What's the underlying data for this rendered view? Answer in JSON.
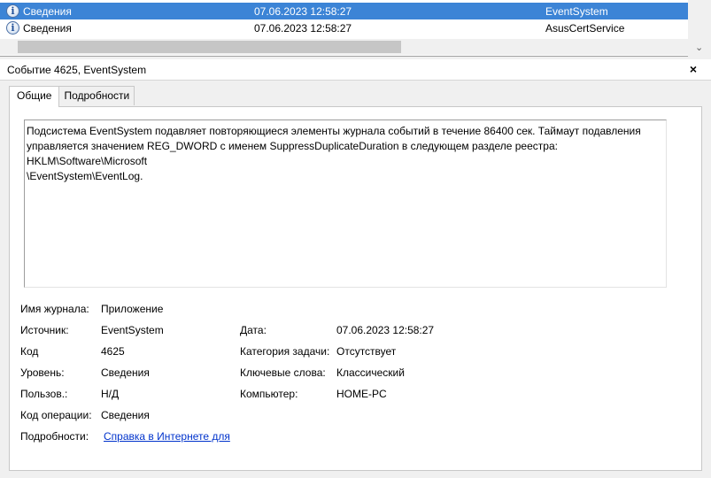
{
  "events": [
    {
      "level": "Сведения",
      "date": "07.06.2023 12:58:27",
      "source": "EventSystem",
      "selected": true
    },
    {
      "level": "Сведения",
      "date": "07.06.2023 12:58:27",
      "source": "AsusCertService",
      "selected": false
    }
  ],
  "detail": {
    "title": "Событие 4625, EventSystem",
    "close": "×",
    "tabs": [
      "Общие",
      "Подробности"
    ],
    "description": "Подсистема EventSystem подавляет повторяющиеся элементы журнала событий в течение 86400 сек.  Таймаут подавления\nуправляется значением REG_DWORD с именем SuppressDuplicateDuration в следующем разделе реестра: HKLM\\Software\\Microsoft\n\\EventSystem\\EventLog.",
    "fields": {
      "log_name_label": "Имя журнала:",
      "log_name": "Приложение",
      "source_label": "Источник:",
      "source": "EventSystem",
      "date_label": "Дата:",
      "date": "07.06.2023 12:58:27",
      "code_label": "Код",
      "code": "4625",
      "task_label": "Категория задачи:",
      "task": "Отсутствует",
      "level_label": "Уровень:",
      "level": "Сведения",
      "keywords_label": "Ключевые слова:",
      "keywords": "Классический",
      "user_label": "Пользов.:",
      "user": "Н/Д",
      "computer_label": "Компьютер:",
      "computer": "HOME-PC",
      "opcode_label": "Код операции:",
      "opcode": "Сведения",
      "more_label": "Подробности:",
      "more_link": "Справка в Интернете для"
    }
  }
}
